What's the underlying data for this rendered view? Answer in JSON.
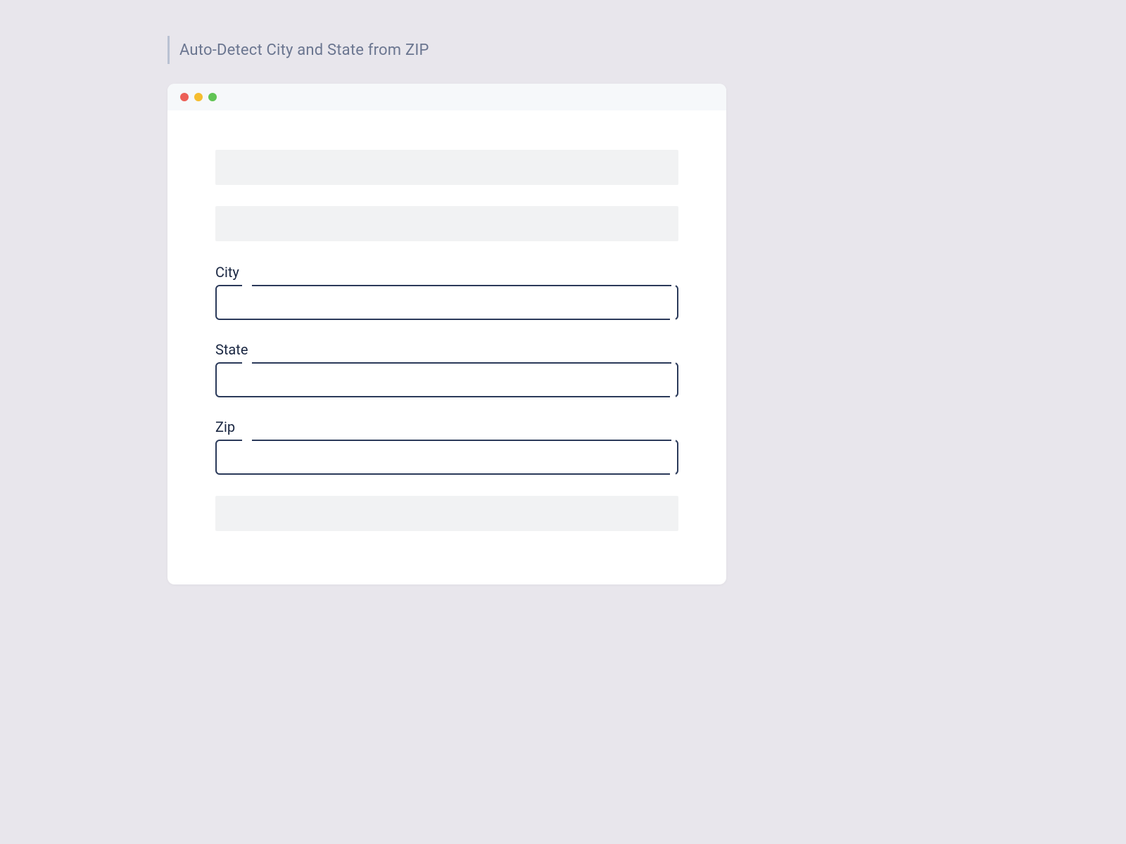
{
  "header": {
    "title": "Auto-Detect City and State from ZIP"
  },
  "window": {
    "traffic_lights": [
      "close",
      "minimize",
      "zoom"
    ]
  },
  "form": {
    "city": {
      "label": "City",
      "value": ""
    },
    "state": {
      "label": "State",
      "value": ""
    },
    "zip": {
      "label": "Zip",
      "value": ""
    }
  }
}
